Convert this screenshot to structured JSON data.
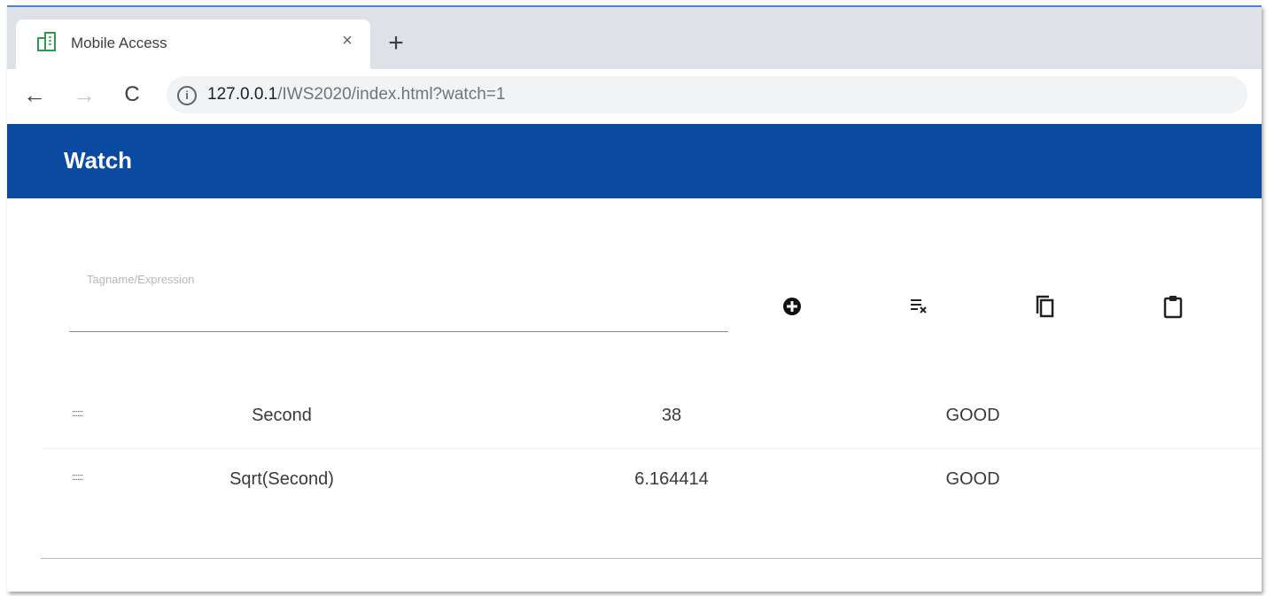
{
  "browser": {
    "tab_title": "Mobile Access",
    "tab_close": "×",
    "new_tab": "+",
    "back": "←",
    "forward": "→",
    "reload": "C",
    "info": "i",
    "url_host": "127.0.0.1",
    "url_path": "/IWS2020/index.html?watch=1"
  },
  "app": {
    "title": "Watch"
  },
  "expression": {
    "label": "Tagname/Expression",
    "value": ""
  },
  "actions": {
    "add": "add-circle-icon",
    "clear": "clear-all-icon",
    "copy": "copy-icon",
    "paste": "paste-icon"
  },
  "rows": [
    {
      "handle": "::::::",
      "name": "Second",
      "value": "38",
      "status": "GOOD"
    },
    {
      "handle": "::::::",
      "name": "Sqrt(Second)",
      "value": "6.164414",
      "status": "GOOD"
    }
  ],
  "colors": {
    "header": "#0a4aa1",
    "accent_tab_icon": "#2e9b4f"
  }
}
